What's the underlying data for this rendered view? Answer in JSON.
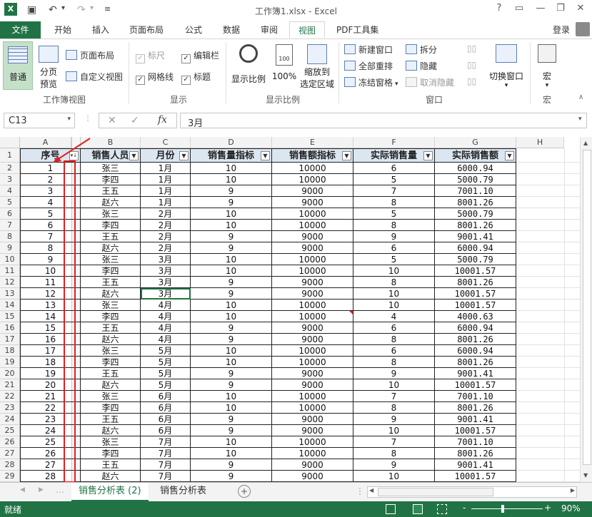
{
  "window": {
    "title": "工作簿1.xlsx - Excel",
    "login": "登录",
    "help": "?"
  },
  "tabs": [
    "文件",
    "开始",
    "插入",
    "页面布局",
    "公式",
    "数据",
    "审阅",
    "视图",
    "PDF工具集"
  ],
  "active_tab": "视图",
  "ribbon": {
    "workbook_views": {
      "normal": "普通",
      "page_break_1": "分页",
      "page_break_2": "预览",
      "page_layout": "页面布局",
      "custom_views": "自定义视图",
      "group": "工作簿视图"
    },
    "show": {
      "ruler": "标尺",
      "formula_bar": "编辑栏",
      "gridlines": "网格线",
      "headings": "标题",
      "group": "显示"
    },
    "zoom": {
      "zoom": "显示比例",
      "hundred": "100%",
      "zoom_sel_1": "缩放到",
      "zoom_sel_2": "选定区域",
      "group": "显示比例",
      "icon_text": "100"
    },
    "window": {
      "new_window": "新建窗口",
      "arrange_all": "全部重排",
      "freeze": "冻结窗格",
      "split": "拆分",
      "hide": "隐藏",
      "unhide": "取消隐藏",
      "switch": "切换窗口",
      "group": "窗口"
    },
    "macros": {
      "macros": "宏",
      "group": "宏"
    }
  },
  "formula_bar": {
    "name_box": "C13",
    "value": "3月",
    "fx": "fx",
    "cancel": "✕",
    "enter": "✓"
  },
  "columns": [
    "A",
    "B",
    "C",
    "D",
    "E",
    "F",
    "G",
    "H"
  ],
  "headers": [
    "序号",
    "销售人员",
    "月份",
    "销售量指标",
    "销售额指标",
    "实际销售量",
    "实际销售额"
  ],
  "rows": [
    [
      "1",
      "张三",
      "1月",
      "10",
      "10000",
      "6",
      "6000.94"
    ],
    [
      "2",
      "李四",
      "1月",
      "10",
      "10000",
      "5",
      "5000.79"
    ],
    [
      "3",
      "王五",
      "1月",
      "9",
      "9000",
      "7",
      "7001.10"
    ],
    [
      "4",
      "赵六",
      "1月",
      "9",
      "9000",
      "8",
      "8001.26"
    ],
    [
      "5",
      "张三",
      "2月",
      "10",
      "10000",
      "5",
      "5000.79"
    ],
    [
      "6",
      "李四",
      "2月",
      "10",
      "10000",
      "8",
      "8001.26"
    ],
    [
      "7",
      "王五",
      "2月",
      "9",
      "9000",
      "9",
      "9001.41"
    ],
    [
      "8",
      "赵六",
      "2月",
      "9",
      "9000",
      "6",
      "6000.94"
    ],
    [
      "9",
      "张三",
      "3月",
      "10",
      "10000",
      "5",
      "5000.79"
    ],
    [
      "10",
      "李四",
      "3月",
      "10",
      "10000",
      "10",
      "10001.57"
    ],
    [
      "11",
      "王五",
      "3月",
      "9",
      "9000",
      "8",
      "8001.26"
    ],
    [
      "12",
      "赵六",
      "3月",
      "9",
      "9000",
      "10",
      "10001.57"
    ],
    [
      "13",
      "张三",
      "4月",
      "10",
      "10000",
      "10",
      "10001.57"
    ],
    [
      "14",
      "李四",
      "4月",
      "10",
      "10000",
      "4",
      "4000.63"
    ],
    [
      "15",
      "王五",
      "4月",
      "9",
      "9000",
      "6",
      "6000.94"
    ],
    [
      "16",
      "赵六",
      "4月",
      "9",
      "9000",
      "8",
      "8001.26"
    ],
    [
      "17",
      "张三",
      "5月",
      "10",
      "10000",
      "6",
      "6000.94"
    ],
    [
      "18",
      "李四",
      "5月",
      "10",
      "10000",
      "8",
      "8001.26"
    ],
    [
      "19",
      "王五",
      "5月",
      "9",
      "9000",
      "9",
      "9001.41"
    ],
    [
      "20",
      "赵六",
      "5月",
      "9",
      "9000",
      "10",
      "10001.57"
    ],
    [
      "21",
      "张三",
      "6月",
      "10",
      "10000",
      "7",
      "7001.10"
    ],
    [
      "22",
      "李四",
      "6月",
      "10",
      "10000",
      "8",
      "8001.26"
    ],
    [
      "23",
      "王五",
      "6月",
      "9",
      "9000",
      "9",
      "9001.41"
    ],
    [
      "24",
      "赵六",
      "6月",
      "9",
      "9000",
      "10",
      "10001.57"
    ],
    [
      "25",
      "张三",
      "7月",
      "10",
      "10000",
      "7",
      "7001.10"
    ],
    [
      "26",
      "李四",
      "7月",
      "10",
      "10000",
      "8",
      "8001.26"
    ],
    [
      "27",
      "王五",
      "7月",
      "9",
      "9000",
      "9",
      "9001.41"
    ],
    [
      "28",
      "赵六",
      "7月",
      "9",
      "9000",
      "10",
      "10001.57"
    ]
  ],
  "row_numbers": [
    "1",
    "2",
    "3",
    "4",
    "5",
    "6",
    "7",
    "8",
    "9",
    "10",
    "11",
    "12",
    "13",
    "14",
    "15",
    "16",
    "17",
    "18",
    "19",
    "20",
    "21",
    "22",
    "23",
    "24",
    "25",
    "26",
    "27",
    "28",
    "29"
  ],
  "sheets": [
    "销售分析表 (2)",
    "销售分析表"
  ],
  "active_sheet": "销售分析表 (2)",
  "status": {
    "ready": "就绪",
    "zoom": "90%",
    "minus": "-",
    "plus": "+"
  },
  "colors": {
    "accent": "#217346",
    "header_fill": "#dce6f1",
    "highlight": "#e02020"
  }
}
